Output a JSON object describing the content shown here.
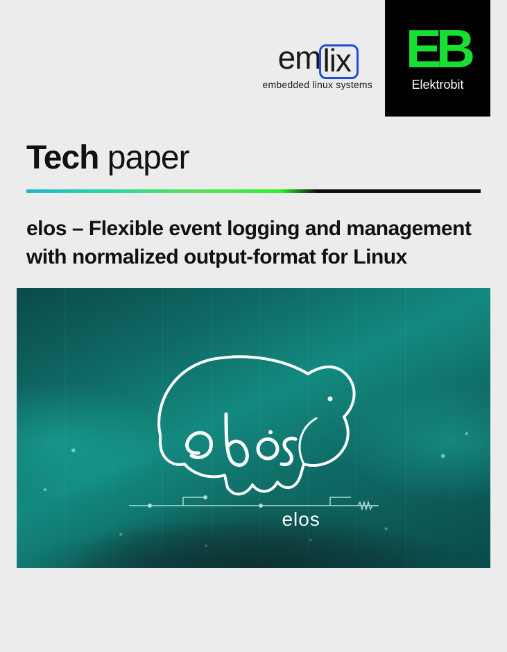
{
  "logos": {
    "emlix": {
      "prefix": "em",
      "mid": "lix",
      "tagline": "embedded linux systems"
    },
    "elektrobit": {
      "mark": "EB",
      "name": "Elektrobit"
    }
  },
  "title": {
    "bold": "Tech",
    "light": " paper"
  },
  "subtitle": "elos – Flexible event logging and management with normalized output-format for Linux",
  "hero": {
    "product_label": "elos"
  },
  "colors": {
    "accent_green": "#18e031",
    "accent_blue": "#1e4fd9",
    "hero_teal": "#138a80"
  }
}
